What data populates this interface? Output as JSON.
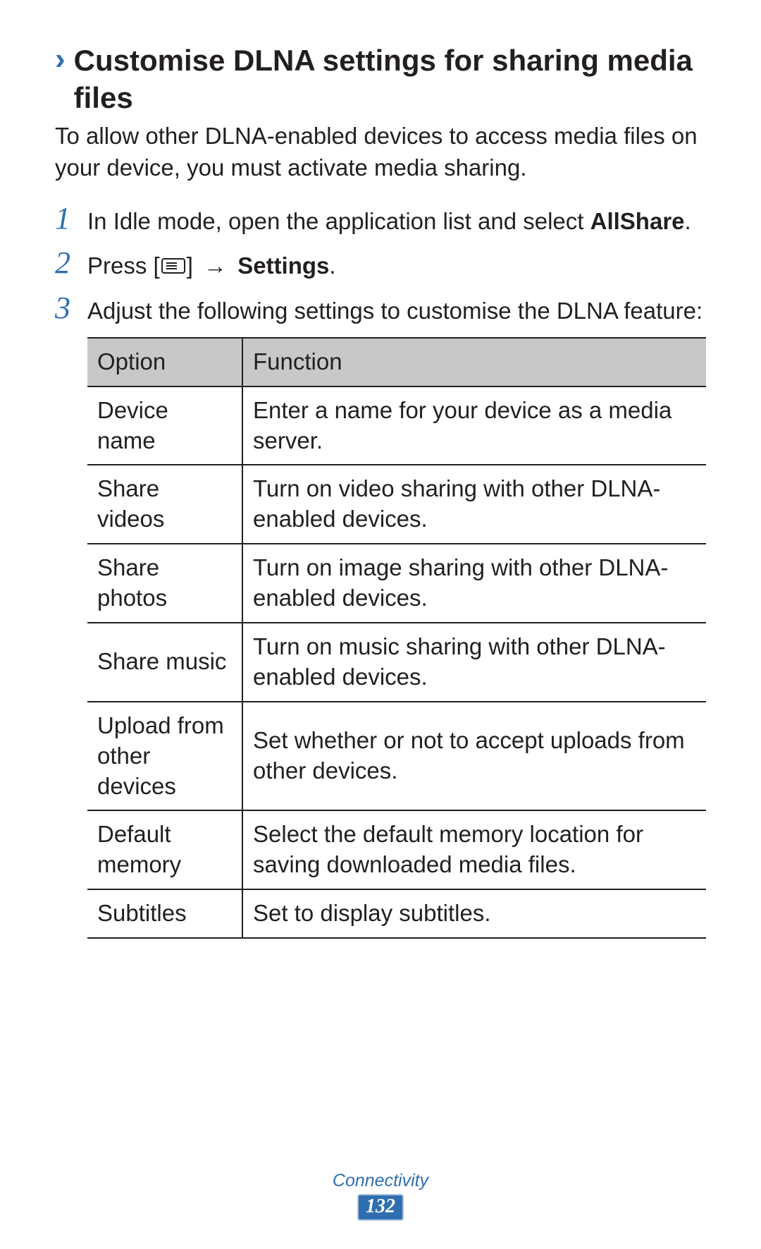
{
  "heading": {
    "chevron": "›",
    "text": "Customise DLNA settings for sharing media files"
  },
  "intro": "To allow other DLNA-enabled devices to access media files on your device, you must activate media sharing.",
  "steps": {
    "s1": {
      "num": "1",
      "pre": "In Idle mode, open the application list and select ",
      "bold": "AllShare",
      "post": "."
    },
    "s2": {
      "num": "2",
      "pre": "Press [",
      "post_bracket": "] ",
      "arrow": "→ ",
      "bold": "Settings",
      "post": "."
    },
    "s3": {
      "num": "3",
      "text": "Adjust the following settings to customise the DLNA feature:"
    }
  },
  "table": {
    "head": {
      "option": "Option",
      "function": "Function"
    },
    "rows": [
      {
        "option": "Device name",
        "function": "Enter a name for your device as a media server."
      },
      {
        "option": "Share videos",
        "function": "Turn on video sharing with other DLNA-enabled devices."
      },
      {
        "option": "Share photos",
        "function": "Turn on image sharing with other DLNA-enabled devices."
      },
      {
        "option": "Share music",
        "function": "Turn on music sharing with other DLNA-enabled devices."
      },
      {
        "option": "Upload from other devices",
        "function": "Set whether or not to accept uploads from other devices."
      },
      {
        "option": "Default memory",
        "function": "Select the default memory location for saving downloaded media files."
      },
      {
        "option": "Subtitles",
        "function": "Set to display subtitles."
      }
    ]
  },
  "footer": {
    "label": "Connectivity",
    "page": "132"
  }
}
